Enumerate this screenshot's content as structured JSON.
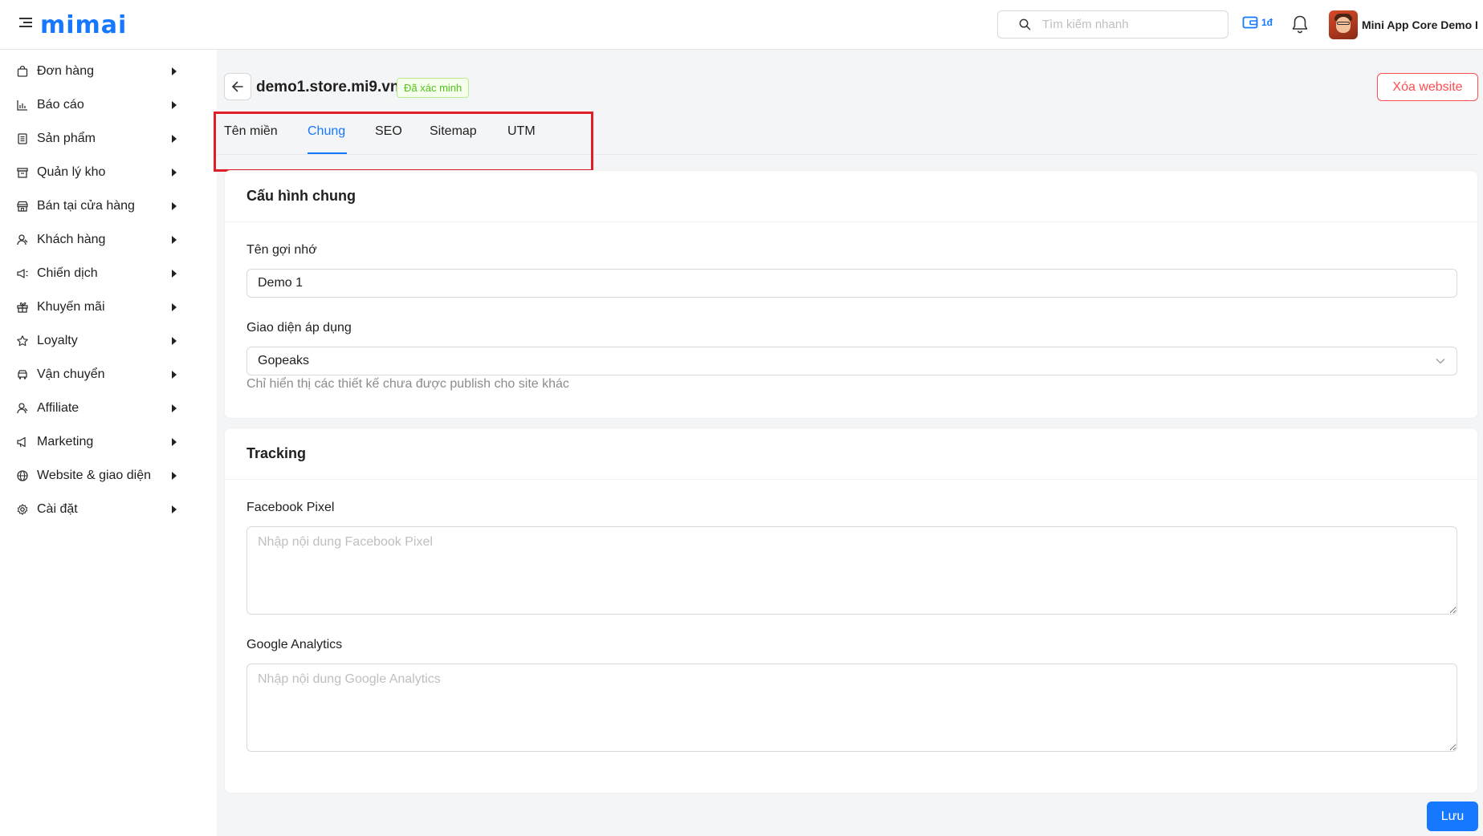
{
  "header": {
    "logo_text": "mimai",
    "search_placeholder": "Tìm kiếm nhanh",
    "wallet_badge": "1đ",
    "user_name": "Mini App Core Demo I"
  },
  "sidebar": {
    "items": [
      {
        "label": "Đơn hàng",
        "icon": "shopping-bag-icon"
      },
      {
        "label": "Báo cáo",
        "icon": "chart-icon"
      },
      {
        "label": "Sản phẩm",
        "icon": "product-list-icon"
      },
      {
        "label": "Quản lý kho",
        "icon": "warehouse-icon"
      },
      {
        "label": "Bán tại cửa hàng",
        "icon": "store-icon"
      },
      {
        "label": "Khách hàng",
        "icon": "customer-icon"
      },
      {
        "label": "Chiến dịch",
        "icon": "megaphone-icon"
      },
      {
        "label": "Khuyến mãi",
        "icon": "gift-icon"
      },
      {
        "label": "Loyalty",
        "icon": "star-icon"
      },
      {
        "label": "Vận chuyển",
        "icon": "truck-icon"
      },
      {
        "label": "Affiliate",
        "icon": "affiliate-icon"
      },
      {
        "label": "Marketing",
        "icon": "marketing-icon"
      },
      {
        "label": "Website & giao diện",
        "icon": "globe-icon"
      },
      {
        "label": "Cài đặt",
        "icon": "gear-icon"
      }
    ]
  },
  "page": {
    "domain": "demo1.store.mi9.vn",
    "verified_label": "Đã xác minh",
    "delete_label": "Xóa website",
    "save_label": "Lưu"
  },
  "tabs": [
    {
      "label": "Tên miền",
      "active": false
    },
    {
      "label": "Chung",
      "active": true
    },
    {
      "label": "SEO",
      "active": false
    },
    {
      "label": "Sitemap",
      "active": false
    },
    {
      "label": "UTM",
      "active": false
    }
  ],
  "general": {
    "title": "Cấu hình chung",
    "nickname_label": "Tên gợi nhớ",
    "nickname_value": "Demo 1",
    "theme_label": "Giao diện áp dụng",
    "theme_value": "Gopeaks",
    "theme_help": "Chỉ hiển thị các thiết kế chưa được publish cho site khác"
  },
  "tracking": {
    "title": "Tracking",
    "facebook_label": "Facebook Pixel",
    "facebook_placeholder": "Nhập nội dung Facebook Pixel",
    "ga_label": "Google Analytics",
    "ga_placeholder": "Nhập nội dung Google Analytics"
  },
  "colors": {
    "primary": "#1677ff",
    "danger": "#ff4d4f",
    "success": "#52c41a",
    "highlight": "#e01e2a"
  }
}
